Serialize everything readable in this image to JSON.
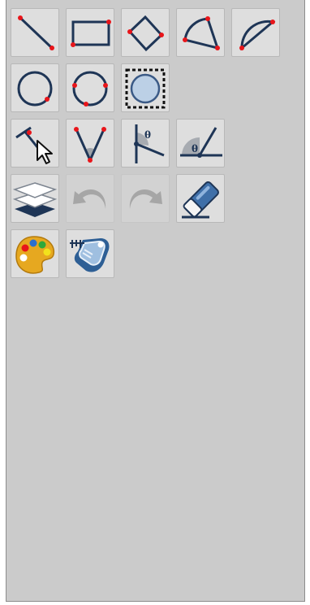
{
  "toolbar": {
    "rows": [
      [
        "segment-tool",
        "rectangle-tool",
        "polygon-tool",
        "sector-tool",
        "arc-tool"
      ],
      [
        "circle-center-point-tool",
        "circle-three-points-tool",
        "circle-in-square-tool"
      ],
      [
        "perpendicular-select-tool",
        "angle-tool",
        "angle-measure-tool",
        "angle-given-size-tool"
      ],
      [
        "layers-tool",
        "undo-tool",
        "redo-tool",
        "eraser-tool"
      ],
      [
        "color-palette-tool",
        "ruler-settings-tool"
      ]
    ],
    "disabled": [
      "undo-tool",
      "redo-tool"
    ]
  },
  "labels": {
    "theta_symbol": "θ"
  },
  "colors": {
    "panel_bg": "#cbcbcb",
    "button_bg": "#dedede",
    "stroke": "#1e3556",
    "point": "#e8151a",
    "disabled_arrow": "#a6a6a6"
  }
}
